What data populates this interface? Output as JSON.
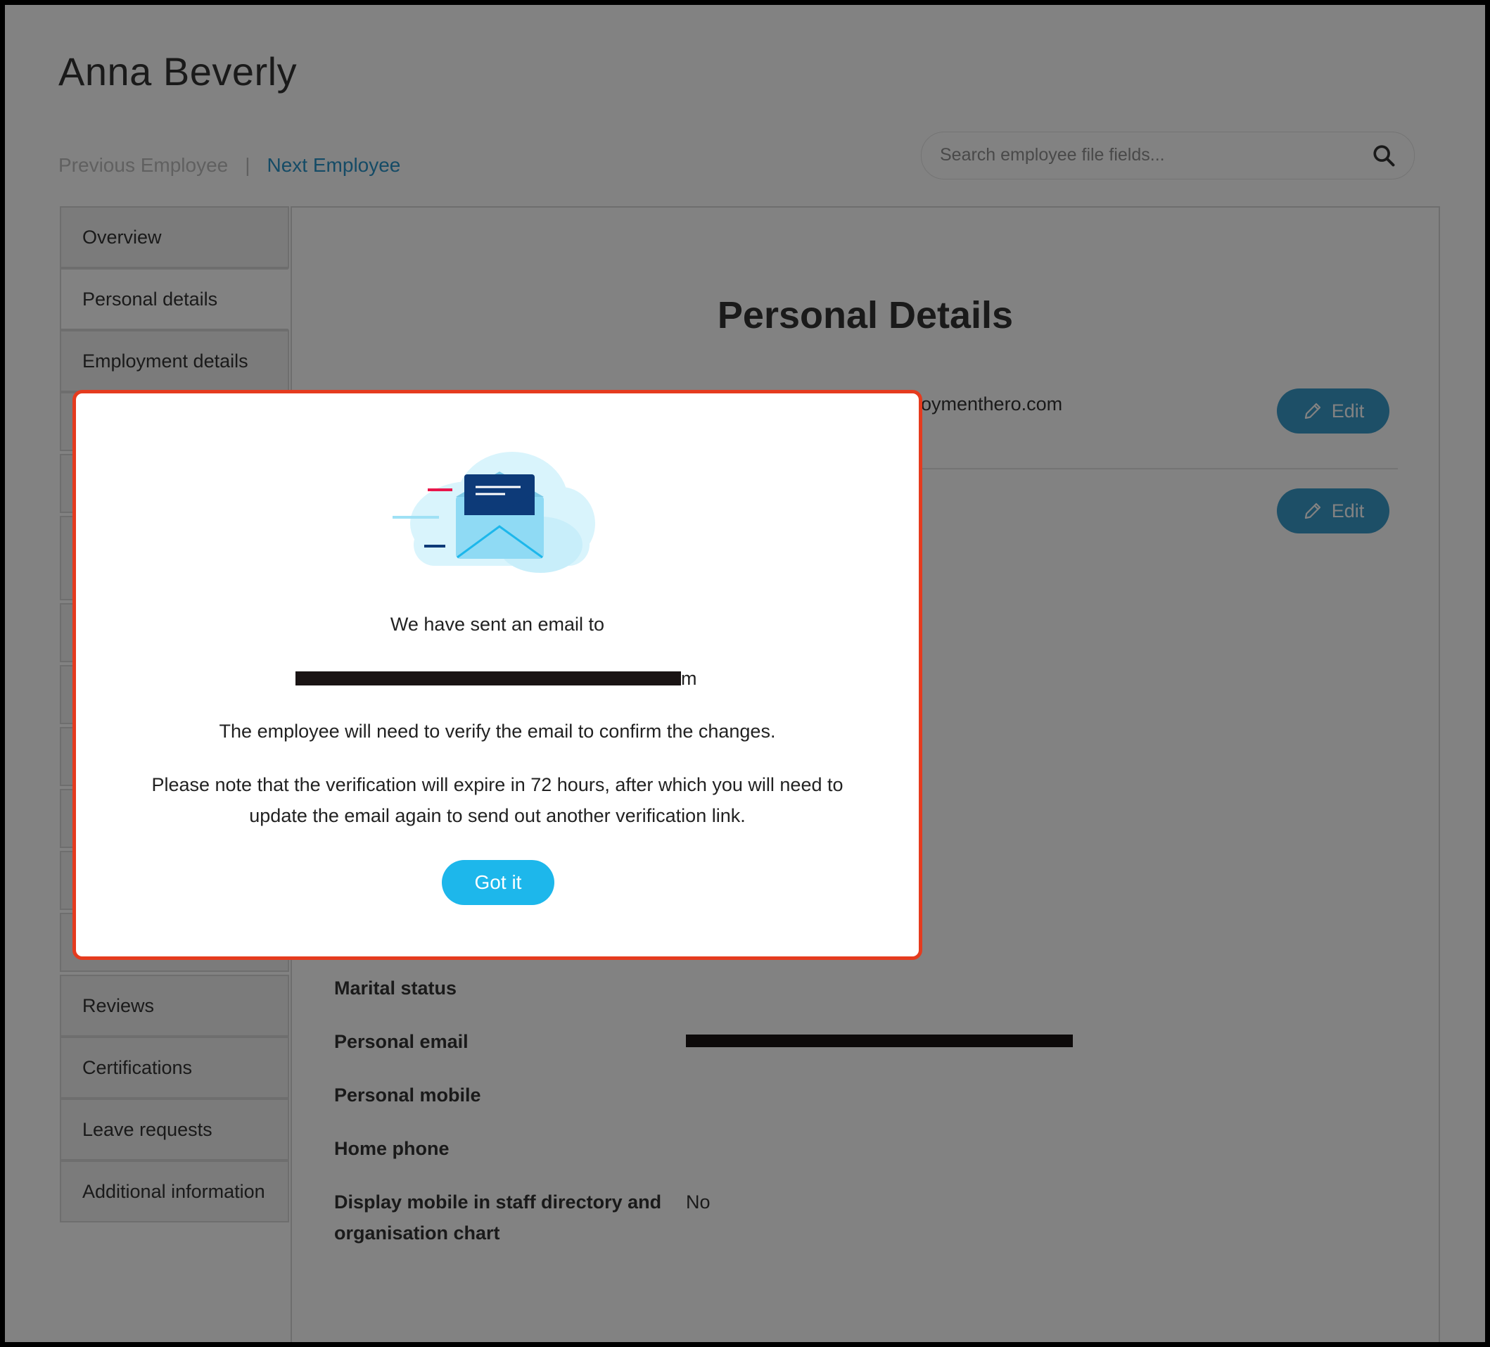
{
  "page": {
    "employee_name": "Anna Beverly",
    "prev_employee": "Previous Employee",
    "nav_separator": "|",
    "next_employee": "Next Employee",
    "search_placeholder": "Search employee file fields..."
  },
  "sidebar": {
    "items": [
      {
        "label": "Overview"
      },
      {
        "label": "Personal details",
        "active": true
      },
      {
        "label": "Employment details"
      },
      {
        "label": "Reviews"
      },
      {
        "label": "Certifications"
      },
      {
        "label": "Leave requests"
      },
      {
        "label": "Additional information"
      }
    ]
  },
  "main": {
    "section_title": "Personal Details",
    "work_email_fragment": "loymenthero.com",
    "edit_label": "Edit",
    "fields": [
      {
        "label": "Marital status",
        "value": ""
      },
      {
        "label": "Personal email",
        "value": "[redacted]"
      },
      {
        "label": "Personal mobile",
        "value": ""
      },
      {
        "label": "Home phone",
        "value": ""
      },
      {
        "label": "Display mobile in staff directory and organisation chart",
        "value": "No"
      }
    ]
  },
  "modal": {
    "line1": "We have sent an email to",
    "email_redacted": "m",
    "line2": "The employee will need to verify the email to confirm the changes.",
    "line3a": "Please note that the verification will expire in 72 hours, after which you will need to",
    "line3b": "update the email again to send out another verification link.",
    "button_label": "Got it",
    "icon": "email-sent-illustration"
  },
  "colors": {
    "accent": "#1db7eb",
    "edit_button": "#3a9ccb",
    "link": "#2a94c9",
    "modal_highlight": "#e53b1e"
  }
}
